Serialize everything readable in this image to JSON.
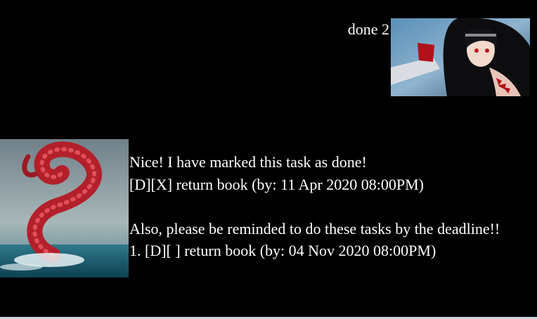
{
  "user_message": {
    "text": "done 2",
    "avatar_icon": "anime-girl-avatar"
  },
  "bot_message": {
    "avatar_icon": "tentacle-avatar",
    "lines": [
      "Nice! I have marked this task as done!",
      "[D][X] return book (by: 11 Apr 2020 08:00PM)",
      "",
      "Also, please be reminded to do these tasks by the deadline!!",
      "1. [D][ ] return book (by: 04 Nov 2020 08:00PM)"
    ]
  },
  "colors": {
    "background": "#000000",
    "text": "#ffffff"
  }
}
